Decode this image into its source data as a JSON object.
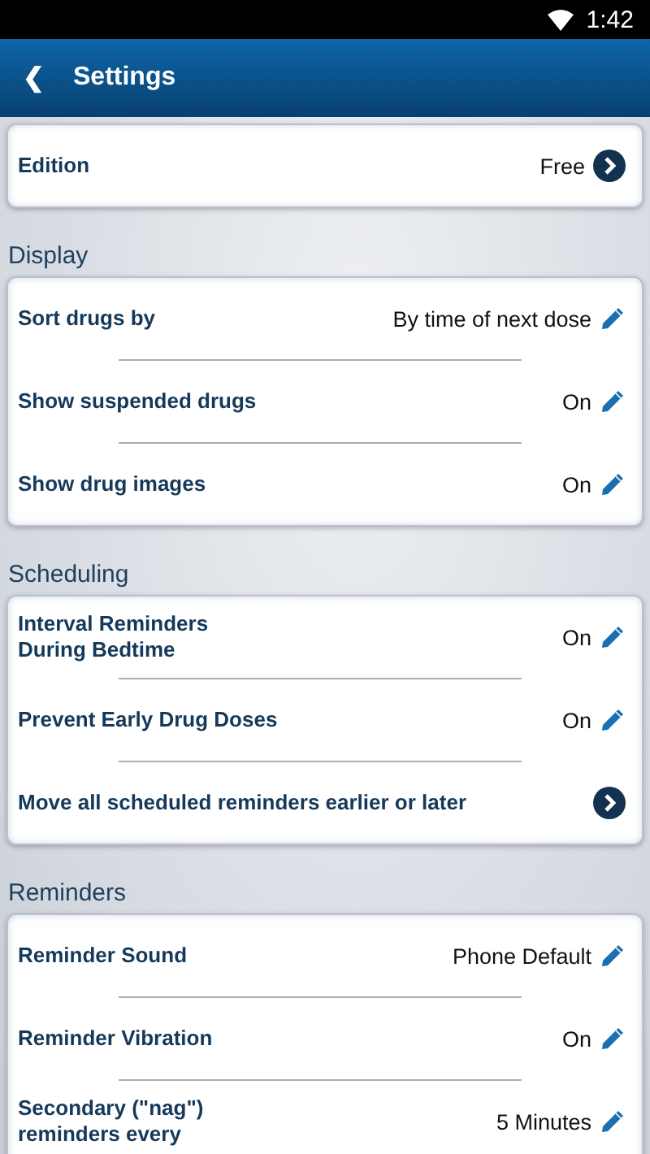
{
  "status_bar": {
    "time": "1:42"
  },
  "header": {
    "back": "❮",
    "title": "Settings"
  },
  "sections": [
    {
      "rows": [
        {
          "kind": "link",
          "label": "Edition",
          "value": "Free"
        }
      ]
    },
    {
      "title": "Display",
      "rows": [
        {
          "kind": "edit",
          "label": "Sort drugs by",
          "value": "By time of next dose"
        },
        {
          "kind": "edit",
          "label": "Show suspended drugs",
          "value": "On"
        },
        {
          "kind": "edit",
          "label": "Show drug images",
          "value": "On"
        }
      ]
    },
    {
      "title": "Scheduling",
      "rows": [
        {
          "kind": "edit",
          "label": "Interval Reminders\nDuring Bedtime",
          "value": "On"
        },
        {
          "kind": "edit",
          "label": "Prevent Early Drug Doses",
          "value": "On"
        },
        {
          "kind": "link",
          "label": "Move all scheduled reminders earlier or later"
        }
      ]
    },
    {
      "title": "Reminders",
      "rows": [
        {
          "kind": "edit",
          "label": "Reminder Sound",
          "value": "Phone Default"
        },
        {
          "kind": "edit",
          "label": "Reminder Vibration",
          "value": "On"
        },
        {
          "kind": "edit",
          "label": "Secondary (\"nag\")\nreminders every",
          "value": "5 Minutes"
        }
      ]
    }
  ]
}
